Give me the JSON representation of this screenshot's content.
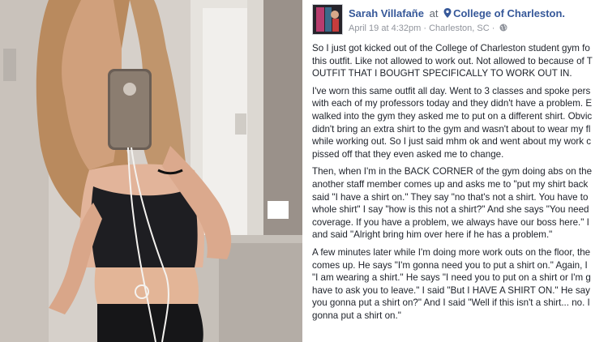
{
  "post": {
    "author": "Sarah Villafañe",
    "at_word": "at",
    "location": "College of Charleston.",
    "date": "April 19 at 4:32pm",
    "separator": "·",
    "city": "Charleston, SC",
    "icons": {
      "location": "map-pin-icon",
      "privacy": "globe-icon"
    },
    "paragraphs": [
      [
        "So I just got kicked out of the College of Charleston student gym fo",
        "this outfit. Like not allowed to work out. Not allowed to because of T",
        "OUTFIT THAT I BOUGHT SPECIFICALLY TO WORK OUT IN."
      ],
      [
        "I've worn this same outfit all day. Went to 3 classes and spoke pers",
        "with each of my professors today and they didn't have a problem. E",
        "walked into the gym they asked me to put on a different shirt. Obvic",
        "didn't bring an extra shirt to the gym and wasn't about to wear my fl",
        "while working out. So I just said mhm ok and went about my work c",
        "pissed off that they even asked me to change."
      ],
      [
        "Then, when I'm in the BACK CORNER of the gym doing abs on the",
        "another staff member comes up and asks me to \"put my shirt back",
        "said \"I have a shirt on.\" They say \"no that's not a shirt. You have to",
        "whole shirt\" I say \"how is this not a shirt?\" And she says \"You need",
        "coverage. If you have a problem, we always have our boss here.\" I",
        "and said \"Alright bring him over here if he has a problem.\""
      ],
      [
        "A few minutes later while I'm doing more work outs on the floor, the",
        "comes up. He says \"I'm gonna need you to put a shirt on.\" Again, I",
        "\"I am wearing a shirt.\" He says \"I need you to put on a shirt or I'm g",
        "have to ask you to leave.\" I said \"But I HAVE A SHIRT ON.\" He say",
        "you gonna put a shirt on?\" And I said \"Well if this isn't a shirt... no. I",
        "gonna put a shirt on.\""
      ]
    ]
  },
  "colors": {
    "link": "#365899",
    "text": "#1d2129",
    "meta": "#90949c"
  }
}
